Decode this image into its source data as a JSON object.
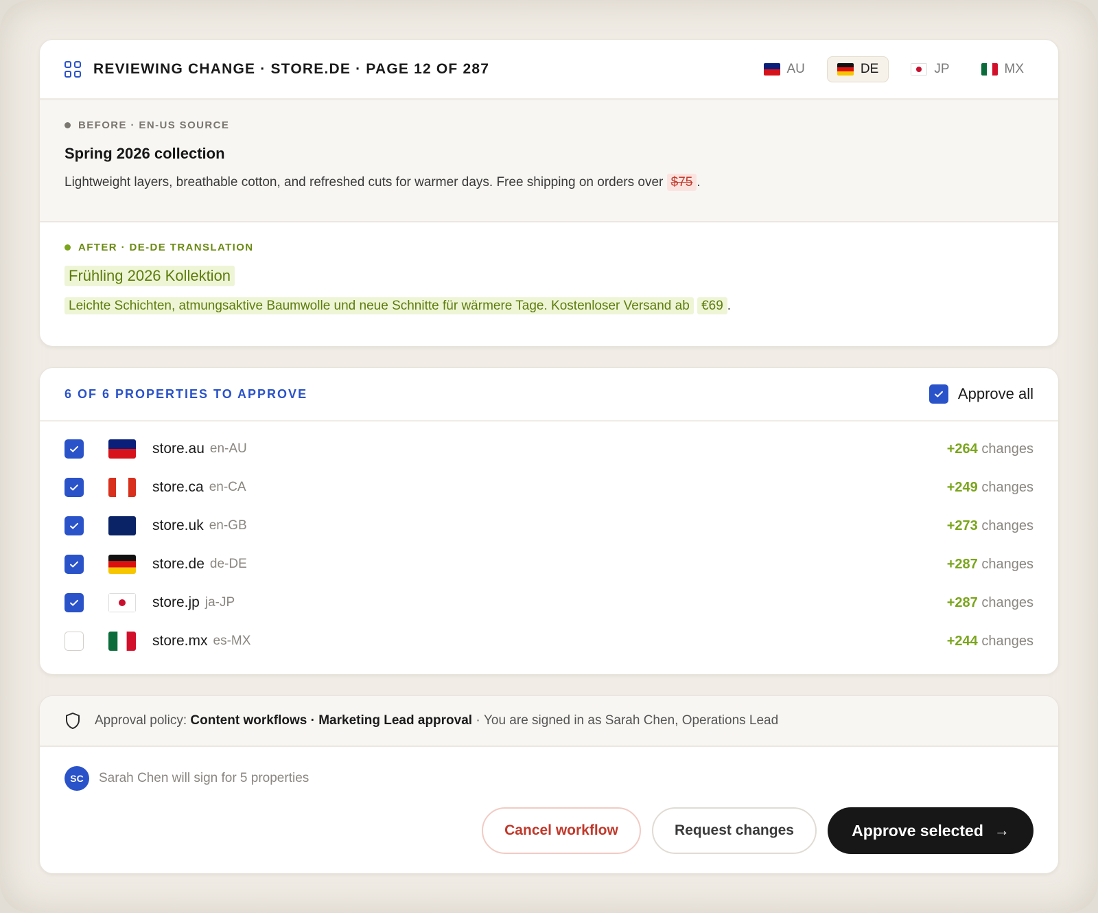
{
  "header": {
    "title": "Reviewing change · store.de · Page 12 of 287",
    "locale_tabs": [
      {
        "code": "AU",
        "active": false
      },
      {
        "code": "DE",
        "active": true
      },
      {
        "code": "JP",
        "active": false
      },
      {
        "code": "MX",
        "active": false
      }
    ]
  },
  "before": {
    "label": "Before · en-US source",
    "heading": "Spring 2026 collection",
    "body_text": "Lightweight layers, breathable cotton, and refreshed cuts for warmer days. Free shipping on orders over",
    "removed_value": "$75",
    "trailing": "."
  },
  "after": {
    "label": "After · de-DE translation",
    "heading": "Frühling 2026 Kollektion",
    "body_text": "Leichte Schichten, atmungsaktive Baumwolle und neue Schnitte für wärmere Tage. Kostenloser Versand ab",
    "added_value": "€69",
    "trailing": "."
  },
  "properties": {
    "title": "6 of 6 properties to approve",
    "approve_all_label": "Approve all",
    "approve_all_checked": true,
    "changes_suffix": "changes",
    "items": [
      {
        "name": "store.au",
        "locale": "en-AU",
        "changes": "+264",
        "checked": true,
        "flag": "au-flag-icon"
      },
      {
        "name": "store.ca",
        "locale": "en-CA",
        "changes": "+249",
        "checked": true,
        "flag": "ca-flag-icon"
      },
      {
        "name": "store.uk",
        "locale": "en-GB",
        "changes": "+273",
        "checked": true,
        "flag": "uk-flag-icon"
      },
      {
        "name": "store.de",
        "locale": "de-DE",
        "changes": "+287",
        "checked": true,
        "flag": "de-flag-icon"
      },
      {
        "name": "store.jp",
        "locale": "ja-JP",
        "changes": "+287",
        "checked": true,
        "flag": "jp-flag-icon"
      },
      {
        "name": "store.mx",
        "locale": "es-MX",
        "changes": "+244",
        "checked": false,
        "flag": "mx-flag-icon"
      }
    ]
  },
  "policy": {
    "prefix": "Approval policy:",
    "workflow": "Content workflows · Marketing Lead approval",
    "separator": "·",
    "signed_in": "You are signed in as Sarah Chen, Operations Lead"
  },
  "signer": {
    "initials": "SC",
    "text": "Sarah Chen will sign for 5 properties"
  },
  "actions": {
    "cancel_label": "Cancel workflow",
    "request_label": "Request changes",
    "approve_label": "Approve selected"
  },
  "colors": {
    "accent": "#2a52c9",
    "added": "#7aa51c",
    "removed": "#c0392b",
    "primary_button": "#171717"
  }
}
